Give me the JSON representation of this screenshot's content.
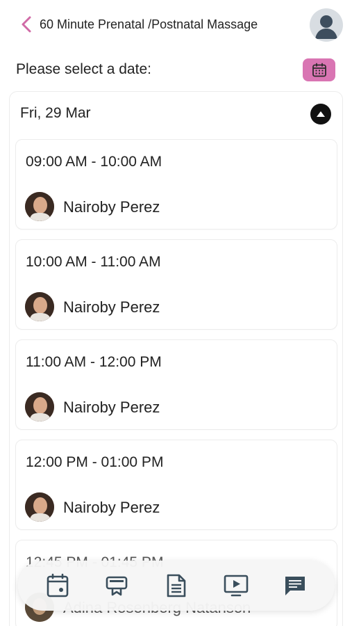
{
  "header": {
    "title": "60 Minute Prenatal /Postnatal Massage",
    "back_icon": "chevron-left-icon",
    "back_color": "#d06aa6"
  },
  "date_prompt": "Please select a date:",
  "calendar_button": {
    "icon": "calendar-icon",
    "color": "#d975b3"
  },
  "date_group": {
    "label": "Fri, 29 Mar",
    "toggle_icon": "chevron-up-circle-icon",
    "slots": [
      {
        "time": "09:00 AM - 10:00 AM",
        "staff": "Nairoby Perez"
      },
      {
        "time": "10:00 AM - 11:00 AM",
        "staff": "Nairoby Perez"
      },
      {
        "time": "11:00 AM - 12:00 PM",
        "staff": "Nairoby Perez"
      },
      {
        "time": "12:00 PM - 01:00 PM",
        "staff": "Nairoby Perez"
      },
      {
        "time": "12:45 PM - 01:45 PM",
        "staff": "Adina Rosenberg Natanson"
      }
    ]
  },
  "bottom_nav": {
    "items": [
      {
        "icon": "calendar-icon"
      },
      {
        "icon": "classes-icon"
      },
      {
        "icon": "document-icon"
      },
      {
        "icon": "video-icon"
      },
      {
        "icon": "chat-icon"
      }
    ]
  }
}
